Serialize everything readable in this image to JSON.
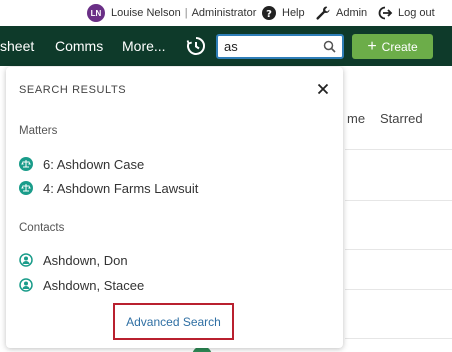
{
  "topbar": {
    "avatar_initials": "LN",
    "user_name": "Louise Nelson",
    "separator": "|",
    "role": "Administrator",
    "help_label": "Help",
    "admin_label": "Admin",
    "logout_label": "Log out"
  },
  "nav": {
    "items": [
      "sheet",
      "Comms",
      "More..."
    ],
    "search_value": "as",
    "create_label": "Create",
    "create_icon": "+"
  },
  "background": {
    "tabs": [
      "me",
      "Starred"
    ]
  },
  "dropdown": {
    "title": "SEARCH RESULTS",
    "sections": [
      {
        "label": "Matters",
        "items": [
          "6: Ashdown Case",
          "4: Ashdown Farms Lawsuit"
        ]
      },
      {
        "label": "Contacts",
        "items": [
          "Ashdown, Don",
          "Ashdown, Stacee"
        ]
      }
    ],
    "advanced_search_label": "Advanced Search"
  },
  "colors": {
    "nav_bg": "#0e3a2a",
    "create_green": "#6cad49",
    "icon_teal": "#1a9c8a",
    "highlight_red": "#b9202f",
    "link_blue": "#2f6fa3",
    "avatar_purple": "#6a2f86"
  },
  "icons": {
    "help": "help-icon",
    "admin": "wrench-icon",
    "logout": "logout-icon",
    "timer": "timer-icon",
    "search": "search-icon",
    "close": "close-icon",
    "matter": "scales-icon",
    "contact": "person-icon"
  }
}
